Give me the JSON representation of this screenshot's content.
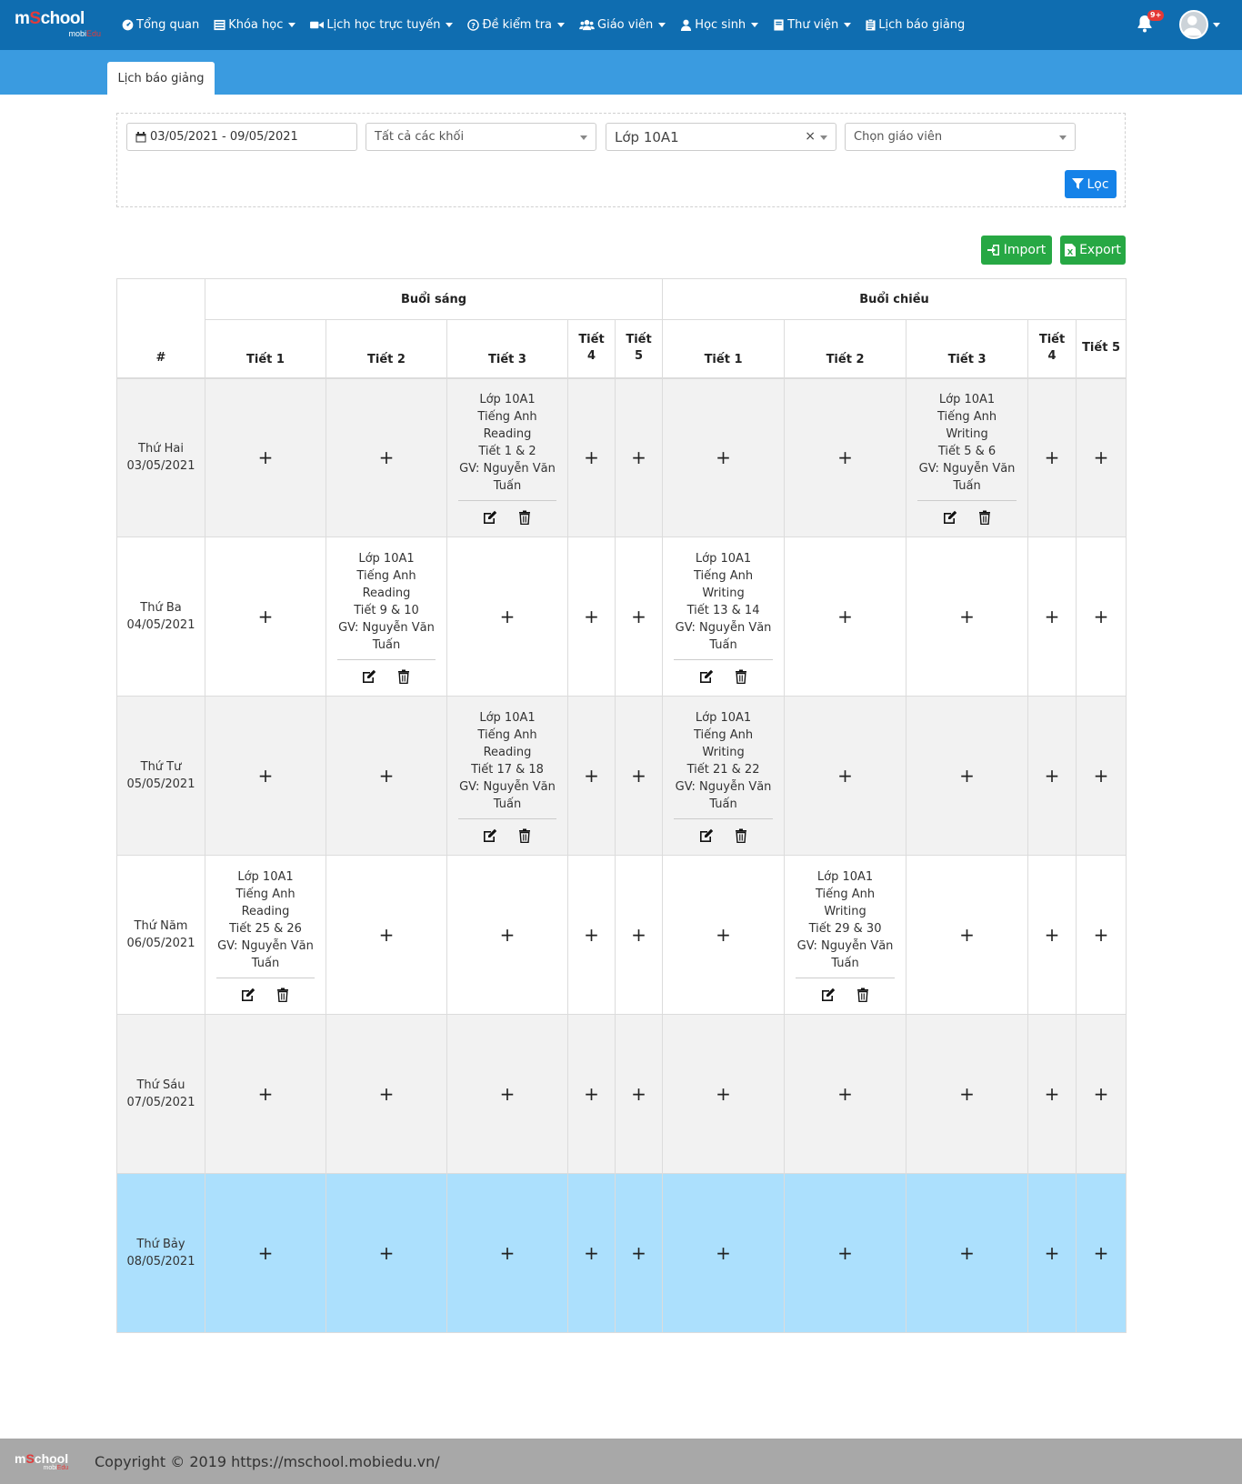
{
  "brand": {
    "logo_main_1": "m",
    "logo_main_s": "S",
    "logo_main_2": "chool",
    "logo_sub_1": "mobi",
    "logo_sub_2": "Edu"
  },
  "nav": {
    "items": [
      {
        "label": "Tổng quan",
        "icon": "dashboard-icon",
        "dropdown": false
      },
      {
        "label": "Khóa học",
        "icon": "list-icon",
        "dropdown": true
      },
      {
        "label": "Lịch học trực tuyến",
        "icon": "video-icon",
        "dropdown": true
      },
      {
        "label": "Đề kiểm tra",
        "icon": "question-icon",
        "dropdown": true
      },
      {
        "label": "Giáo viên",
        "icon": "users-icon",
        "dropdown": true
      },
      {
        "label": "Học sinh",
        "icon": "user-icon",
        "dropdown": true
      },
      {
        "label": "Thư viện",
        "icon": "book-icon",
        "dropdown": true
      },
      {
        "label": "Lịch báo giảng",
        "icon": "clipboard-icon",
        "dropdown": false
      }
    ],
    "notification_badge": "9+"
  },
  "subtab": {
    "label": "Lịch báo giảng"
  },
  "filters": {
    "date_range": "03/05/2021 - 09/05/2021",
    "grade": "Tất cả các khối",
    "class": "Lớp 10A1",
    "teacher_placeholder": "Chọn giáo viên",
    "filter_button": "Lọc"
  },
  "actions": {
    "import_label": "Import",
    "export_label": "Export"
  },
  "table": {
    "index_header": "#",
    "morning_header": "Buổi sáng",
    "afternoon_header": "Buổi chiều",
    "period_headers": [
      "Tiết 1",
      "Tiết 2",
      "Tiết 3",
      "Tiết 4",
      "Tiết 5",
      "Tiết 1",
      "Tiết 2",
      "Tiết 3",
      "Tiết 4",
      "Tiết 5"
    ],
    "add_symbol": "+",
    "days": [
      {
        "name": "Thứ Hai",
        "date": "03/05/2021",
        "style": "gray",
        "cells": [
          null,
          null,
          {
            "class": "Lớp 10A1",
            "subject": "Tiếng Anh",
            "topic": "Reading",
            "periods": "Tiết 1 & 2",
            "teacher": "GV: Nguyễn Văn Tuấn"
          },
          null,
          null,
          null,
          null,
          {
            "class": "Lớp 10A1",
            "subject": "Tiếng Anh",
            "topic": "Writing",
            "periods": "Tiết 5 & 6",
            "teacher": "GV: Nguyễn Văn Tuấn"
          },
          null,
          null
        ]
      },
      {
        "name": "Thứ Ba",
        "date": "04/05/2021",
        "style": "white",
        "cells": [
          null,
          {
            "class": "Lớp 10A1",
            "subject": "Tiếng Anh",
            "topic": "Reading",
            "periods": "Tiết 9 & 10",
            "teacher": "GV: Nguyễn Văn Tuấn"
          },
          null,
          null,
          null,
          {
            "class": "Lớp 10A1",
            "subject": "Tiếng Anh",
            "topic": "Writing",
            "periods": "Tiết 13 & 14",
            "teacher": "GV: Nguyễn Văn Tuấn"
          },
          null,
          null,
          null,
          null
        ]
      },
      {
        "name": "Thứ Tư",
        "date": "05/05/2021",
        "style": "gray",
        "cells": [
          null,
          null,
          {
            "class": "Lớp 10A1",
            "subject": "Tiếng Anh",
            "topic": "Reading",
            "periods": "Tiết 17 & 18",
            "teacher": "GV: Nguyễn Văn Tuấn"
          },
          null,
          null,
          {
            "class": "Lớp 10A1",
            "subject": "Tiếng Anh",
            "topic": "Writing",
            "periods": "Tiết 21 & 22",
            "teacher": "GV: Nguyễn Văn Tuấn"
          },
          null,
          null,
          null,
          null
        ]
      },
      {
        "name": "Thứ Năm",
        "date": "06/05/2021",
        "style": "white",
        "cells": [
          {
            "class": "Lớp 10A1",
            "subject": "Tiếng Anh",
            "topic": "Reading",
            "periods": "Tiết 25 & 26",
            "teacher": "GV: Nguyễn Văn Tuấn"
          },
          null,
          null,
          null,
          null,
          null,
          {
            "class": "Lớp 10A1",
            "subject": "Tiếng Anh",
            "topic": "Writing",
            "periods": "Tiết 29 & 30",
            "teacher": "GV: Nguyễn Văn Tuấn"
          },
          null,
          null,
          null
        ]
      },
      {
        "name": "Thứ Sáu",
        "date": "07/05/2021",
        "style": "gray",
        "cells": [
          null,
          null,
          null,
          null,
          null,
          null,
          null,
          null,
          null,
          null
        ]
      },
      {
        "name": "Thứ Bảy",
        "date": "08/05/2021",
        "style": "blue",
        "cells": [
          null,
          null,
          null,
          null,
          null,
          null,
          null,
          null,
          null,
          null
        ]
      }
    ]
  },
  "footer": {
    "copyright": "Copyright © 2019 https://mschool.mobiedu.vn/"
  },
  "colors": {
    "navbar": "#0f6db0",
    "subbar": "#3a9be0",
    "primary": "#1582e8",
    "success": "#27a844",
    "today_row": "#ace0fd",
    "footer": "#a8a8a8"
  }
}
